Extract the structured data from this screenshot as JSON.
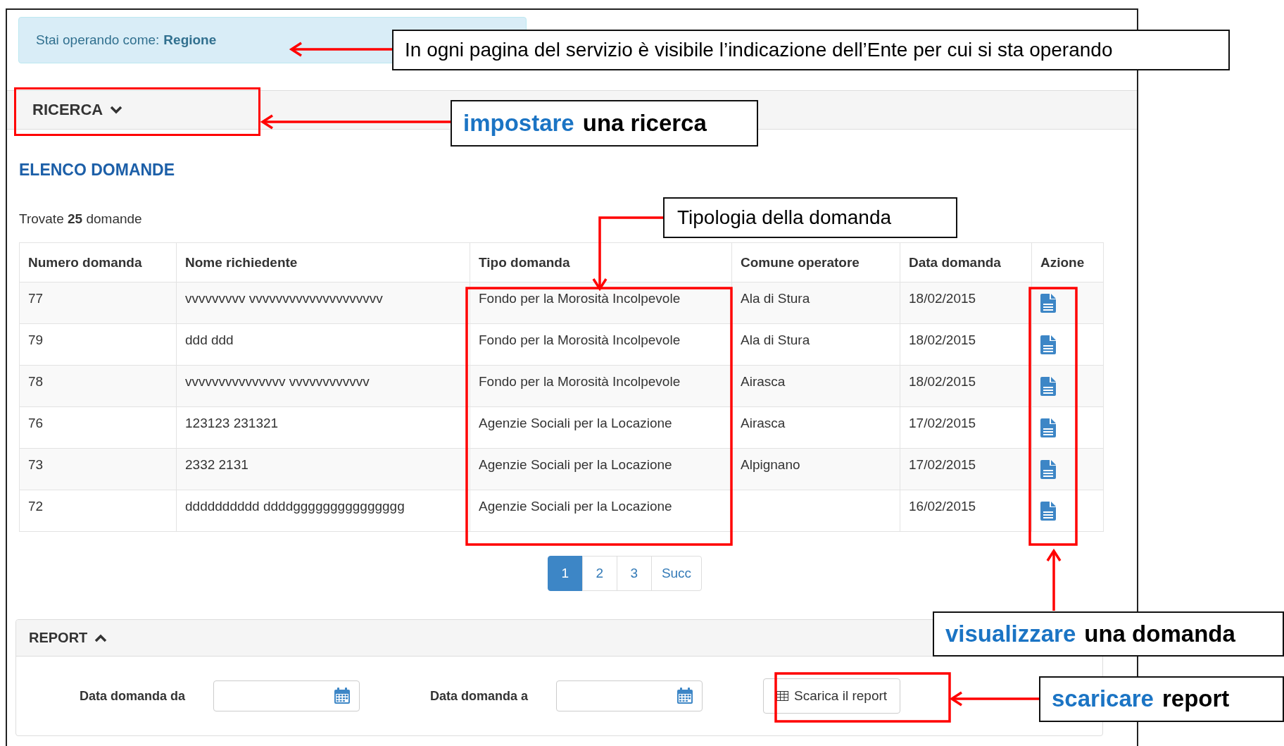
{
  "info_bar": {
    "label": "Stai operando come:",
    "entity": "Regione"
  },
  "search_panel": {
    "title": "RICERCA",
    "expanded": false
  },
  "list": {
    "title": "ELENCO DOMANDE",
    "count_text": "Trovate **25** domande"
  },
  "table": {
    "columns": [
      "Numero domanda",
      "Nome richiedente",
      "Tipo domanda",
      "Comune operatore",
      "Data domanda",
      "Azione"
    ],
    "rows": [
      {
        "number": "77",
        "applicant": "vvvvvvvvv vvvvvvvvvvvvvvvvvvvv",
        "type": "Fondo per la Morosità Incolpevole",
        "municipality": "Ala di Stura",
        "date": "18/02/2015"
      },
      {
        "number": "79",
        "applicant": "ddd ddd",
        "type": "Fondo per la Morosità Incolpevole",
        "municipality": "Ala di Stura",
        "date": "18/02/2015"
      },
      {
        "number": "78",
        "applicant": "vvvvvvvvvvvvvvv vvvvvvvvvvvv",
        "type": "Fondo per la Morosità Incolpevole",
        "municipality": "Airasca",
        "date": "18/02/2015"
      },
      {
        "number": "76",
        "applicant": "123123 231321",
        "type": "Agenzie Sociali per la Locazione",
        "municipality": "Airasca",
        "date": "17/02/2015"
      },
      {
        "number": "73",
        "applicant": "2332 2131",
        "type": "Agenzie Sociali per la Locazione",
        "municipality": "Alpignano",
        "date": "17/02/2015"
      },
      {
        "number": "72",
        "applicant": "dddddddddd ddddggggggggggggggg",
        "type": "Agenzie Sociali per la Locazione",
        "date": "16/02/2015"
      }
    ]
  },
  "pagination": {
    "pages": [
      {
        "label": "1",
        "selected": true
      },
      {
        "label": "2",
        "selected": false
      },
      {
        "label": "3",
        "selected": false
      }
    ],
    "next": "Succ"
  },
  "report_panel": {
    "title": "REPORT",
    "expanded": true,
    "fields": [
      {
        "label": "Data domanda da"
      },
      {
        "label": "Data domanda a"
      }
    ],
    "button": "Scarica il report"
  },
  "annotations": [
    {
      "text": "In ogni pagina del servizio è visibile l’indicazione dell’Ente per cui si sta operando"
    },
    {
      "highlight": "impostare",
      "text": "una ricerca"
    },
    {
      "text": "Tipologia della domanda"
    },
    {
      "highlight": "visualizzare",
      "text": "una domanda"
    },
    {
      "highlight": "scaricare",
      "text": "report"
    }
  ]
}
